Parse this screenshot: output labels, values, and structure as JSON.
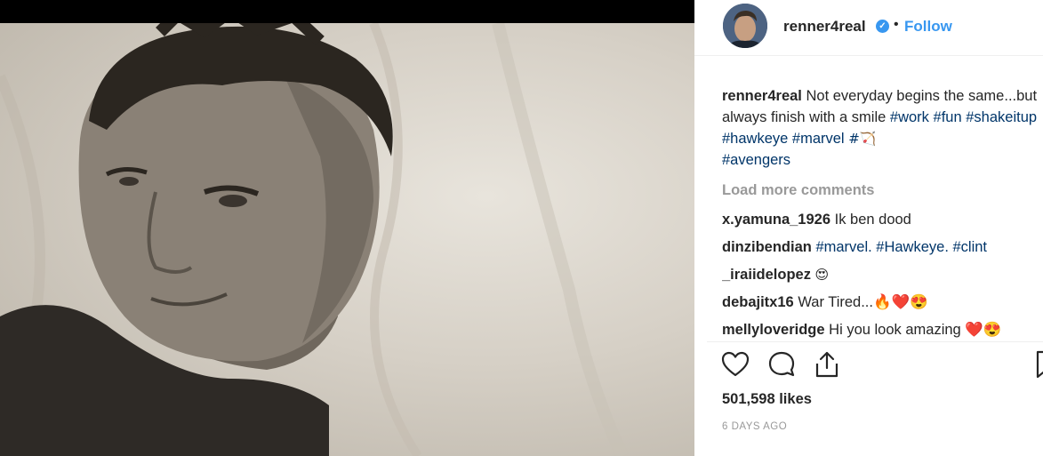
{
  "post": {
    "username": "renner4real",
    "follow_label": "Follow",
    "dot": "•",
    "verified_mark": "✓",
    "caption_text": "Not everyday begins the same...but always finish with a smile",
    "caption_tags": [
      "#work",
      "#fun",
      "#shakeitup",
      "#hawkeye",
      "#marvel",
      "#🏹",
      "#avengers"
    ],
    "load_more": "Load more comments",
    "comments": [
      {
        "user": "x.yamuna_1926",
        "text": "Ik ben dood"
      },
      {
        "user": "dinzibendian",
        "text": "#marvel. #Hawkeye. #clint"
      },
      {
        "user": "_iraiidelopez",
        "text": "😍"
      },
      {
        "user": "debajitx16",
        "text": "War Tired...🔥❤️😍"
      },
      {
        "user": "mellyloveridge",
        "text": "Hi you look amazing ❤️😍"
      }
    ],
    "likes": "501,598 likes",
    "date": "6 DAYS AGO"
  },
  "icons": {
    "like": "heart-icon",
    "comment": "comment-bubble-icon",
    "share": "share-icon",
    "save": "bookmark-icon",
    "verified": "verified-badge-icon"
  },
  "colors": {
    "link_blue": "#3897f0",
    "hashtag": "#003569",
    "muted": "#999999",
    "text": "#262626"
  }
}
